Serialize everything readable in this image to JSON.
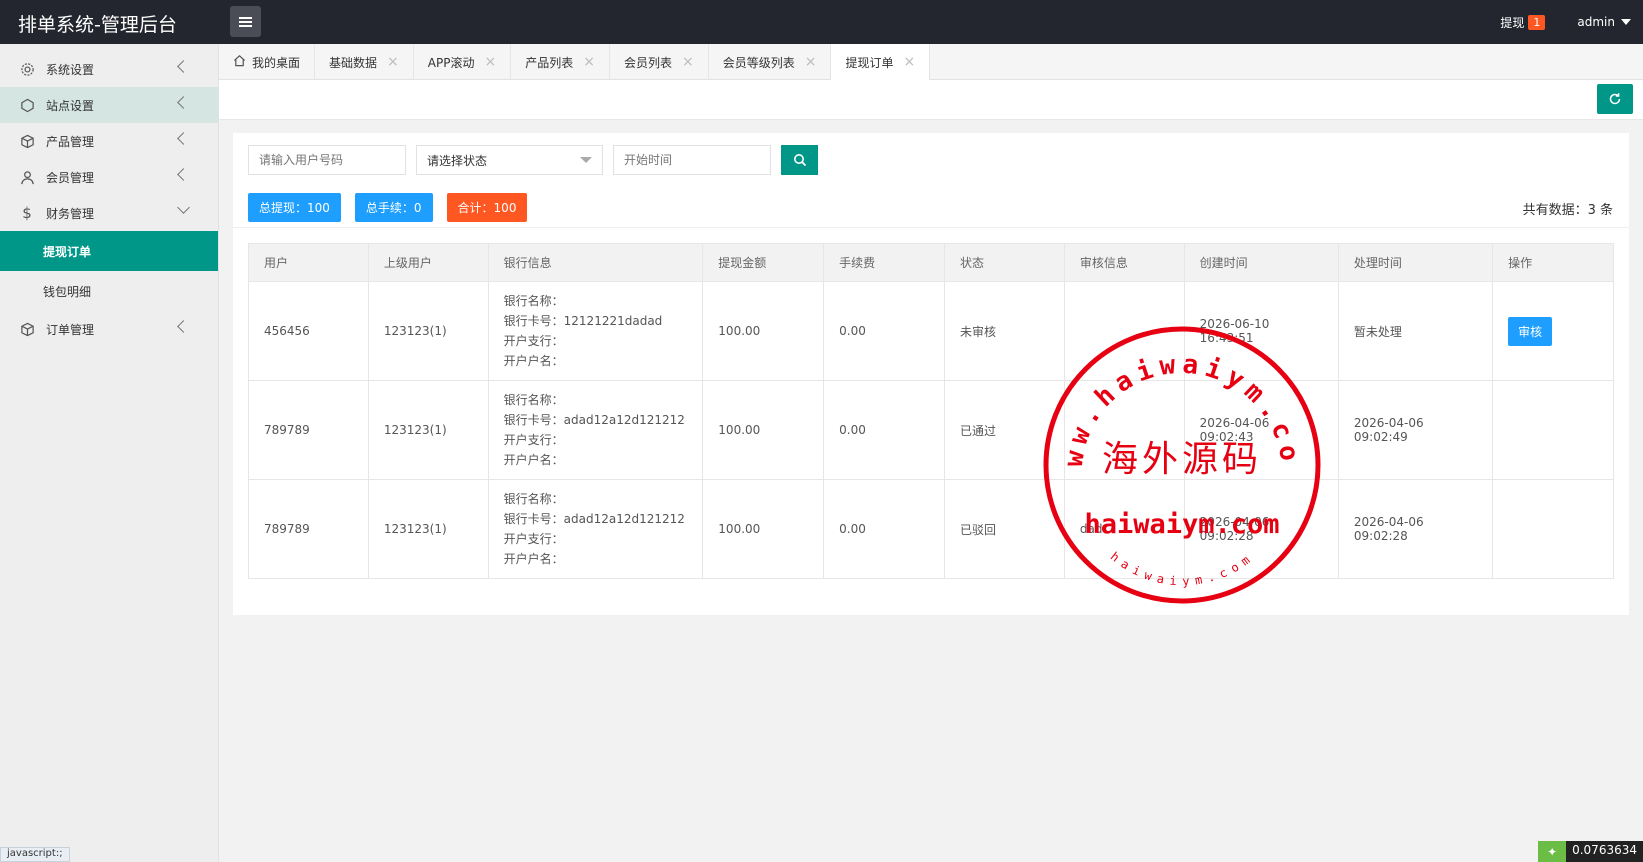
{
  "app": {
    "title": "排单系统-管理后台"
  },
  "header": {
    "withdraw_label": "提现",
    "withdraw_count": "1",
    "user_name": "admin"
  },
  "sidebar": {
    "items": [
      {
        "label": "系统设置",
        "icon": "gear-icon"
      },
      {
        "label": "站点设置",
        "icon": "site-icon"
      },
      {
        "label": "产品管理",
        "icon": "cube-icon"
      },
      {
        "label": "会员管理",
        "icon": "user-icon"
      },
      {
        "label": "财务管理",
        "icon": "dollar-icon"
      },
      {
        "label": "订单管理",
        "icon": "cube-icon"
      }
    ],
    "finance_sub": [
      {
        "label": "提现订单"
      },
      {
        "label": "钱包明细"
      }
    ]
  },
  "tabs": [
    {
      "label": "我的桌面"
    },
    {
      "label": "基础数据"
    },
    {
      "label": "APP滚动"
    },
    {
      "label": "产品列表"
    },
    {
      "label": "会员列表"
    },
    {
      "label": "会员等级列表"
    },
    {
      "label": "提现订单"
    }
  ],
  "filters": {
    "user_placeholder": "请输入用户号码",
    "status_selected": "请选择状态",
    "time_placeholder": "开始时间"
  },
  "stats": {
    "total_withdraw": "总提现：100",
    "total_fee": "总手续：0",
    "total_sum": "合计：100",
    "total_count": "共有数据：3 条"
  },
  "table": {
    "headers": [
      "用户",
      "上级用户",
      "银行信息",
      "提现金额",
      "手续费",
      "状态",
      "审核信息",
      "创建时间",
      "处理时间",
      "操作"
    ],
    "rows": [
      {
        "user": "456456",
        "parent": "123123(1)",
        "bank_name": "银行名称：",
        "bank_card": "银行卡号：12121221dadad",
        "bank_branch": "开户支行：",
        "bank_holder": "开户户名：",
        "amount": "100.00",
        "fee": "0.00",
        "status": "未审核",
        "audit_info": "",
        "created": "2026-06-10 16:43:51",
        "processed": "暂未处理",
        "action": "审核"
      },
      {
        "user": "789789",
        "parent": "123123(1)",
        "bank_name": "银行名称：",
        "bank_card": "银行卡号：adad12a12d121212",
        "bank_branch": "开户支行：",
        "bank_holder": "开户户名：",
        "amount": "100.00",
        "fee": "0.00",
        "status": "已通过",
        "audit_info": "",
        "created": "2026-04-06 09:02:43",
        "processed": "2026-04-06 09:02:49",
        "action": ""
      },
      {
        "user": "789789",
        "parent": "123123(1)",
        "bank_name": "银行名称：",
        "bank_card": "银行卡号：adad12a12d121212",
        "bank_branch": "开户支行：",
        "bank_holder": "开户户名：",
        "amount": "100.00",
        "fee": "0.00",
        "status": "已驳回",
        "audit_info": "dad",
        "created": "2026-04-06 09:02:28",
        "processed": "2026-04-06 09:02:28",
        "action": ""
      }
    ]
  },
  "watermark": {
    "arc_top": "www.haiwaiym.com",
    "center_cn": "海外源码",
    "center_en": "haiwaiym.com",
    "arc_bottom": "haiwaiym.com",
    "color": "#e60012"
  },
  "footer": {
    "status_tip": "javascript:;",
    "meter_value": "0.0763634"
  },
  "colors": {
    "accent": "#009688",
    "blue": "#1e9fff",
    "orange": "#ff5722",
    "header_bg": "#23262e"
  }
}
